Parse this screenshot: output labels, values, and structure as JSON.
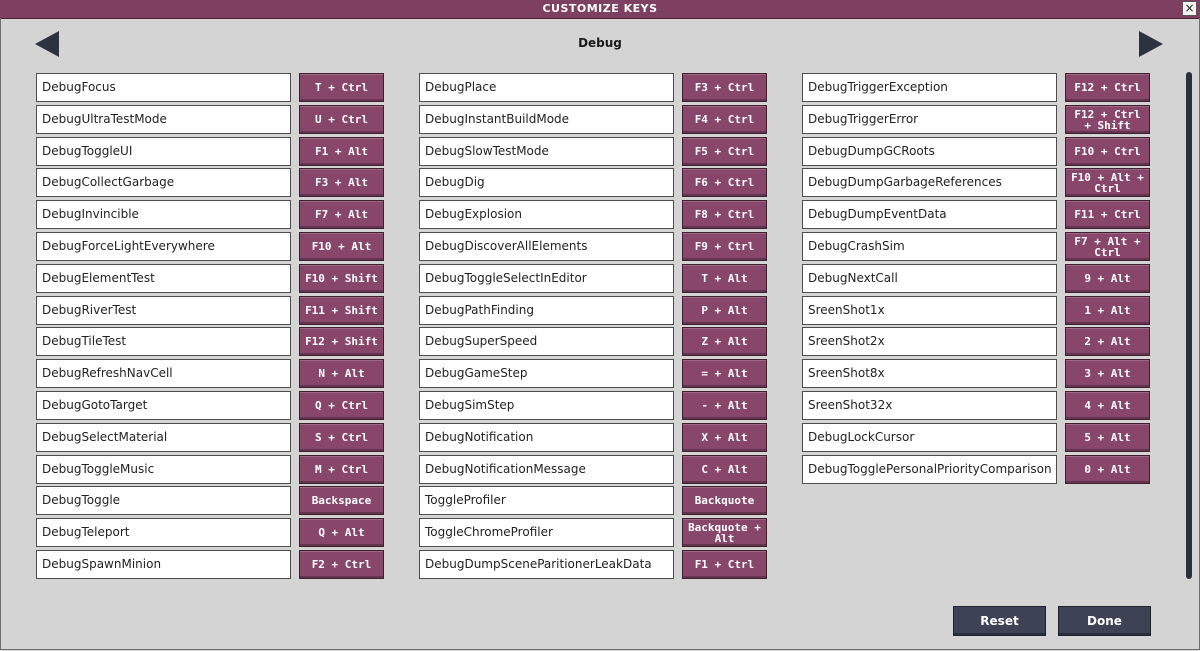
{
  "window": {
    "title": "CUSTOMIZE KEYS",
    "close_label": "×"
  },
  "page": {
    "title": "Debug"
  },
  "columns": [
    {
      "bindings": [
        {
          "action": "DebugFocus",
          "key": "T + Ctrl"
        },
        {
          "action": "DebugUltraTestMode",
          "key": "U + Ctrl"
        },
        {
          "action": "DebugToggleUI",
          "key": "F1 + Alt"
        },
        {
          "action": "DebugCollectGarbage",
          "key": "F3 + Alt"
        },
        {
          "action": "DebugInvincible",
          "key": "F7 + Alt"
        },
        {
          "action": "DebugForceLightEverywhere",
          "key": "F10 + Alt"
        },
        {
          "action": "DebugElementTest",
          "key": "F10 + Shift"
        },
        {
          "action": "DebugRiverTest",
          "key": "F11 + Shift"
        },
        {
          "action": "DebugTileTest",
          "key": "F12 + Shift"
        },
        {
          "action": "DebugRefreshNavCell",
          "key": "N + Alt"
        },
        {
          "action": "DebugGotoTarget",
          "key": "Q + Ctrl"
        },
        {
          "action": "DebugSelectMaterial",
          "key": "S + Ctrl"
        },
        {
          "action": "DebugToggleMusic",
          "key": "M + Ctrl"
        },
        {
          "action": "DebugToggle",
          "key": "Backspace"
        },
        {
          "action": "DebugTeleport",
          "key": "Q + Alt"
        },
        {
          "action": "DebugSpawnMinion",
          "key": "F2 + Ctrl"
        }
      ]
    },
    {
      "bindings": [
        {
          "action": "DebugPlace",
          "key": "F3 + Ctrl"
        },
        {
          "action": "DebugInstantBuildMode",
          "key": "F4 + Ctrl"
        },
        {
          "action": "DebugSlowTestMode",
          "key": "F5 + Ctrl"
        },
        {
          "action": "DebugDig",
          "key": "F6 + Ctrl"
        },
        {
          "action": "DebugExplosion",
          "key": "F8 + Ctrl"
        },
        {
          "action": "DebugDiscoverAllElements",
          "key": "F9 + Ctrl"
        },
        {
          "action": "DebugToggleSelectInEditor",
          "key": "T + Alt"
        },
        {
          "action": "DebugPathFinding",
          "key": "P + Alt"
        },
        {
          "action": "DebugSuperSpeed",
          "key": "Z + Alt"
        },
        {
          "action": "DebugGameStep",
          "key": "= + Alt"
        },
        {
          "action": "DebugSimStep",
          "key": "- + Alt"
        },
        {
          "action": "DebugNotification",
          "key": "X + Alt"
        },
        {
          "action": "DebugNotificationMessage",
          "key": "C + Alt"
        },
        {
          "action": "ToggleProfiler",
          "key": "Backquote"
        },
        {
          "action": "ToggleChromeProfiler",
          "key": "Backquote + Alt"
        },
        {
          "action": "DebugDumpSceneParitionerLeakData",
          "key": "F1 + Ctrl"
        }
      ]
    },
    {
      "bindings": [
        {
          "action": "DebugTriggerException",
          "key": "F12 + Ctrl"
        },
        {
          "action": "DebugTriggerError",
          "key": "F12 + Ctrl + Shift"
        },
        {
          "action": "DebugDumpGCRoots",
          "key": "F10 + Ctrl"
        },
        {
          "action": "DebugDumpGarbageReferences",
          "key": "F10 + Alt + Ctrl"
        },
        {
          "action": "DebugDumpEventData",
          "key": "F11 + Ctrl"
        },
        {
          "action": "DebugCrashSim",
          "key": "F7 + Alt + Ctrl"
        },
        {
          "action": "DebugNextCall",
          "key": "9 + Alt"
        },
        {
          "action": "SreenShot1x",
          "key": "1 + Alt"
        },
        {
          "action": "SreenShot2x",
          "key": "2 + Alt"
        },
        {
          "action": "SreenShot8x",
          "key": "3 + Alt"
        },
        {
          "action": "SreenShot32x",
          "key": "4 + Alt"
        },
        {
          "action": "DebugLockCursor",
          "key": "5 + Alt"
        },
        {
          "action": "DebugTogglePersonalPriorityComparison",
          "key": "0 + Alt"
        }
      ]
    }
  ],
  "footer": {
    "reset_label": "Reset",
    "done_label": "Done"
  },
  "colors": {
    "title_bar": "#7e4060",
    "key_button": "#87466a",
    "footer_button": "#3d4354",
    "background": "#d4d4d4"
  },
  "icons": {
    "prev": "arrow-left-icon",
    "next": "arrow-right-icon",
    "close": "close-icon"
  }
}
